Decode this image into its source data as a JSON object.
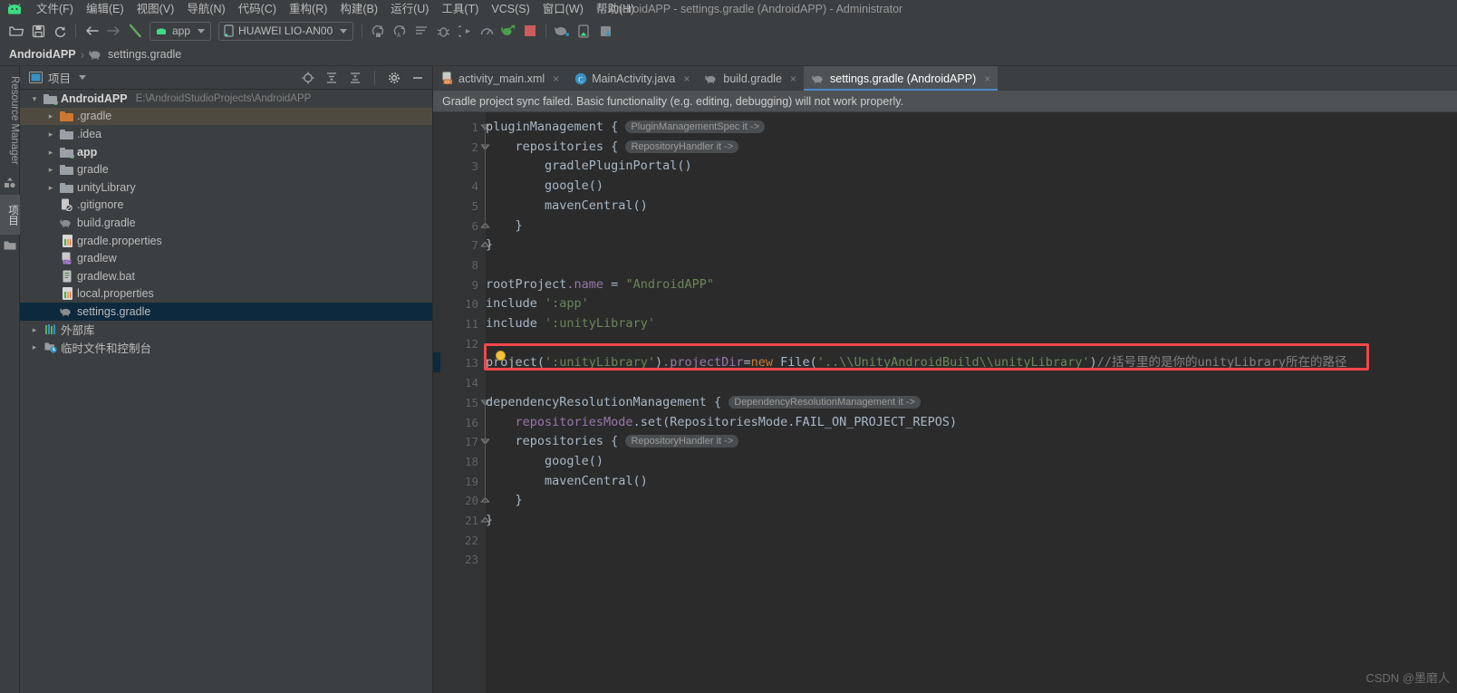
{
  "window": {
    "title": "AndroidAPP - settings.gradle (AndroidAPP) - Administrator"
  },
  "menubar": {
    "logo": "android-logo",
    "items": [
      {
        "label": "文件(F)"
      },
      {
        "label": "编辑(E)"
      },
      {
        "label": "视图(V)"
      },
      {
        "label": "导航(N)"
      },
      {
        "label": "代码(C)"
      },
      {
        "label": "重构(R)"
      },
      {
        "label": "构建(B)"
      },
      {
        "label": "运行(U)"
      },
      {
        "label": "工具(T)"
      },
      {
        "label": "VCS(S)"
      },
      {
        "label": "窗口(W)"
      },
      {
        "label": "帮助(H)"
      }
    ]
  },
  "toolbar": {
    "icons_left": [
      "open-folder-icon",
      "save-icon",
      "sync-icon"
    ],
    "icons_nav": [
      "back-arrow-icon",
      "forward-arrow-icon",
      "build-hammer-icon"
    ],
    "module_selector": "app",
    "device_selector": "HUAWEI LIO-AN00",
    "icons_right": [
      "run-icon",
      "apply-changes-icon",
      "logcat-icon",
      "debug-icon",
      "attach-debugger-icon",
      "profiler-icon",
      "sync-gradle-icon",
      "stop-icon"
    ],
    "icons_far_right": [
      "sdk-manager-icon",
      "avd-manager-icon",
      "device-file-explorer-icon"
    ]
  },
  "breadcrumb": {
    "project": "AndroidAPP",
    "separator": "›",
    "file_icon": "gradle-elephant-icon",
    "file": "settings.gradle"
  },
  "left_strip": {
    "tabs": [
      {
        "label": "Resource Manager",
        "selected": false
      },
      {
        "label": "项目",
        "selected": true
      }
    ]
  },
  "project_panel": {
    "icon": "project-panel-icon",
    "title": "项目",
    "dropdown_caret": "chevron-down-icon",
    "header_icons": [
      "locate-target-icon",
      "expand-all-icon",
      "collapse-all-icon",
      "settings-gear-icon",
      "minimize-icon"
    ],
    "tree": [
      {
        "label": "AndroidAPP",
        "path": "E:\\AndroidStudioProjects\\AndroidAPP",
        "indent": 0,
        "arrow": "open",
        "icon": "module-folder",
        "bold": true,
        "state": "none"
      },
      {
        "label": ".gradle",
        "path": "",
        "indent": 1,
        "arrow": "closed",
        "icon": "folder-orange",
        "bold": false,
        "state": "hover"
      },
      {
        "label": ".idea",
        "path": "",
        "indent": 1,
        "arrow": "closed",
        "icon": "folder",
        "bold": false,
        "state": "none"
      },
      {
        "label": "app",
        "path": "",
        "indent": 1,
        "arrow": "closed",
        "icon": "module-folder",
        "bold": true,
        "state": "none"
      },
      {
        "label": "gradle",
        "path": "",
        "indent": 1,
        "arrow": "closed",
        "icon": "folder",
        "bold": false,
        "state": "none"
      },
      {
        "label": "unityLibrary",
        "path": "",
        "indent": 1,
        "arrow": "closed",
        "icon": "folder",
        "bold": false,
        "state": "none"
      },
      {
        "label": ".gitignore",
        "path": "",
        "indent": 1,
        "arrow": "none",
        "icon": "gitignore-file",
        "bold": false,
        "state": "none"
      },
      {
        "label": "build.gradle",
        "path": "",
        "indent": 1,
        "arrow": "none",
        "icon": "gradle-file",
        "bold": false,
        "state": "none"
      },
      {
        "label": "gradle.properties",
        "path": "",
        "indent": 1,
        "arrow": "none",
        "icon": "properties-file",
        "bold": false,
        "state": "none"
      },
      {
        "label": "gradlew",
        "path": "",
        "indent": 1,
        "arrow": "none",
        "icon": "cpp-file",
        "bold": false,
        "state": "none"
      },
      {
        "label": "gradlew.bat",
        "path": "",
        "indent": 1,
        "arrow": "none",
        "icon": "text-file",
        "bold": false,
        "state": "none"
      },
      {
        "label": "local.properties",
        "path": "",
        "indent": 1,
        "arrow": "none",
        "icon": "properties-file",
        "bold": false,
        "state": "none"
      },
      {
        "label": "settings.gradle",
        "path": "",
        "indent": 1,
        "arrow": "none",
        "icon": "gradle-file",
        "bold": false,
        "state": "selected"
      },
      {
        "label": "外部库",
        "path": "",
        "indent": 0,
        "arrow": "closed",
        "icon": "library-icon",
        "bold": false,
        "state": "none"
      },
      {
        "label": "临时文件和控制台",
        "path": "",
        "indent": 0,
        "arrow": "closed",
        "icon": "scratches-icon",
        "bold": false,
        "state": "none"
      }
    ]
  },
  "editor": {
    "tabs": [
      {
        "label": "activity_main.xml",
        "icon": "xml-layout-icon",
        "active": false,
        "close": "×"
      },
      {
        "label": "MainActivity.java",
        "icon": "java-class-icon",
        "active": false,
        "close": "×"
      },
      {
        "label": "build.gradle",
        "icon": "gradle-elephant-icon",
        "active": false,
        "close": "×"
      },
      {
        "label": "settings.gradle (AndroidAPP)",
        "icon": "gradle-elephant-icon",
        "active": true,
        "close": "×"
      }
    ],
    "sync_banner": "Gradle project sync failed. Basic functionality (e.g. editing, debugging) will not work properly.",
    "line_count": 23,
    "current_line": 13,
    "lines": [
      {
        "n": 1,
        "fold": "collapse",
        "segments": [
          {
            "t": "pluginManagement ",
            "c": "pl"
          },
          {
            "t": "{",
            "c": "pl"
          },
          {
            "t": " ",
            "c": "pl"
          },
          {
            "t": "PluginManagementSpec it ->",
            "c": "hint"
          }
        ]
      },
      {
        "n": 2,
        "fold": "collapse",
        "segments": [
          {
            "t": "    repositories ",
            "c": "pl"
          },
          {
            "t": "{",
            "c": "pl"
          },
          {
            "t": " ",
            "c": "pl"
          },
          {
            "t": "RepositoryHandler it ->",
            "c": "hint"
          }
        ]
      },
      {
        "n": 3,
        "fold": "none",
        "segments": [
          {
            "t": "        gradlePluginPortal()",
            "c": "pl"
          }
        ]
      },
      {
        "n": 4,
        "fold": "none",
        "segments": [
          {
            "t": "        google()",
            "c": "pl"
          }
        ]
      },
      {
        "n": 5,
        "fold": "none",
        "segments": [
          {
            "t": "        mavenCentral()",
            "c": "pl"
          }
        ]
      },
      {
        "n": 6,
        "fold": "end",
        "segments": [
          {
            "t": "    }",
            "c": "pl"
          }
        ]
      },
      {
        "n": 7,
        "fold": "end",
        "segments": [
          {
            "t": "}",
            "c": "pl"
          }
        ]
      },
      {
        "n": 8,
        "fold": "none",
        "segments": []
      },
      {
        "n": 9,
        "fold": "none",
        "segments": [
          {
            "t": "rootProject",
            "c": "pl"
          },
          {
            "t": ".name",
            "c": "pr"
          },
          {
            "t": " = ",
            "c": "pl"
          },
          {
            "t": "\"AndroidAPP\"",
            "c": "s"
          }
        ]
      },
      {
        "n": 10,
        "fold": "none",
        "segments": [
          {
            "t": "include ",
            "c": "pl"
          },
          {
            "t": "':app'",
            "c": "s"
          }
        ]
      },
      {
        "n": 11,
        "fold": "none",
        "segments": [
          {
            "t": "include ",
            "c": "pl"
          },
          {
            "t": "':unityLibrary'",
            "c": "s"
          }
        ]
      },
      {
        "n": 12,
        "fold": "none",
        "segments": []
      },
      {
        "n": 13,
        "fold": "none",
        "segments": [
          {
            "t": "project(",
            "c": "pl"
          },
          {
            "t": "':unityLibrary'",
            "c": "s"
          },
          {
            "t": ")",
            "c": "pl"
          },
          {
            "t": ".projectDir",
            "c": "pr"
          },
          {
            "t": "=",
            "c": "pl"
          },
          {
            "t": "new",
            "c": "k"
          },
          {
            "t": " File(",
            "c": "pl"
          },
          {
            "t": "'..\\\\UnityAndroidBuild\\\\unityLibrary'",
            "c": "s"
          },
          {
            "t": ")",
            "c": "pl"
          },
          {
            "t": "//括号里的是你的unityLibrary所在的路径",
            "c": "cm"
          }
        ]
      },
      {
        "n": 14,
        "fold": "none",
        "segments": []
      },
      {
        "n": 15,
        "fold": "collapse",
        "segments": [
          {
            "t": "dependencyResolutionManagement ",
            "c": "pl"
          },
          {
            "t": "{",
            "c": "pl"
          },
          {
            "t": " ",
            "c": "pl"
          },
          {
            "t": "DependencyResolutionManagement it ->",
            "c": "hint"
          }
        ]
      },
      {
        "n": 16,
        "fold": "none",
        "segments": [
          {
            "t": "    repositoriesMode",
            "c": "pr"
          },
          {
            "t": ".set(RepositoriesMode.FAIL_ON_PROJECT_REPOS)",
            "c": "pl"
          }
        ]
      },
      {
        "n": 17,
        "fold": "collapse",
        "segments": [
          {
            "t": "    repositories ",
            "c": "pl"
          },
          {
            "t": "{",
            "c": "pl"
          },
          {
            "t": " ",
            "c": "pl"
          },
          {
            "t": "RepositoryHandler it ->",
            "c": "hint"
          }
        ]
      },
      {
        "n": 18,
        "fold": "none",
        "segments": [
          {
            "t": "        google()",
            "c": "pl"
          }
        ]
      },
      {
        "n": 19,
        "fold": "none",
        "segments": [
          {
            "t": "        mavenCentral()",
            "c": "pl"
          }
        ]
      },
      {
        "n": 20,
        "fold": "end",
        "segments": [
          {
            "t": "    }",
            "c": "pl"
          }
        ]
      },
      {
        "n": 21,
        "fold": "end",
        "segments": [
          {
            "t": "}",
            "c": "pl"
          }
        ]
      },
      {
        "n": 22,
        "fold": "none",
        "segments": []
      },
      {
        "n": 23,
        "fold": "none",
        "segments": []
      }
    ],
    "annotation": {
      "type": "red-rectangle",
      "target_line": 13
    },
    "intention_bulb": "intention-bulb-icon"
  },
  "watermark": "CSDN @墨磨人",
  "colors": {
    "accent_blue": "#4a88c7",
    "selection_blue": "#0d293e",
    "annotation_red": "#f0474a",
    "panel_bg": "#3c3f41",
    "editor_bg": "#2b2b2b",
    "gutter_bg": "#313335",
    "string_green": "#6a8759",
    "keyword_orange": "#cc7832",
    "property_purple": "#9876aa",
    "comment_grey": "#808080",
    "android_green": "#3ddc84"
  }
}
